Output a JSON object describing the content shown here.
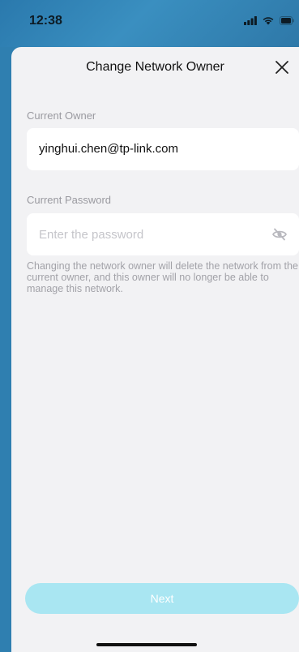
{
  "status_bar": {
    "time": "12:38",
    "icons": [
      "signal-icon",
      "wifi-icon",
      "battery-icon"
    ]
  },
  "header": {
    "title": "Change Network Owner",
    "close_icon": "close-icon"
  },
  "owner": {
    "label": "Current Owner",
    "value": "yinghui.chen@tp-link.com"
  },
  "password": {
    "label": "Current Password",
    "placeholder": "Enter the password",
    "value": "",
    "visibility_icon": "eye-off-icon"
  },
  "note": "Changing the network owner will delete the network from the current owner, and this owner will no longer be able to manage this network.",
  "footer": {
    "next_label": "Next"
  },
  "colors": {
    "accent_disabled": "#a9e6f2",
    "status_bar_bg": "#2f7fb0",
    "sheet_bg": "#f2f2f4"
  }
}
